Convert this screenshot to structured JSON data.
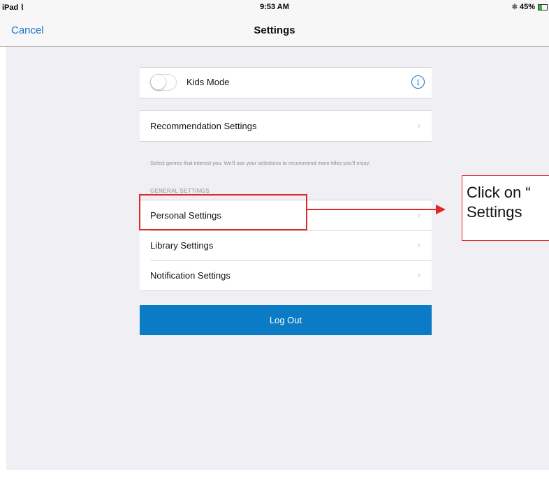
{
  "status_bar": {
    "device": "iPad",
    "time": "9:53 AM",
    "battery": "45%",
    "battery_level": 0.45
  },
  "nav": {
    "cancel_label": "Cancel",
    "title": "Settings"
  },
  "kids_mode": {
    "label": "Kids Mode",
    "enabled": false
  },
  "recommendation": {
    "label": "Recommendation Settings",
    "helper_text": "Select genres that interest you. We'll use your selections to recommend more titles you'll enjoy."
  },
  "general_settings": {
    "header": "GENERAL SETTINGS",
    "items": [
      {
        "label": "Personal Settings"
      },
      {
        "label": "Library Settings"
      },
      {
        "label": "Notification Settings"
      }
    ]
  },
  "logout_label": "Log Out",
  "annotation": {
    "line1": "Click on “",
    "line2": "Settings",
    "color": "#e3262b"
  },
  "colors": {
    "accent": "#1a73c9",
    "logout": "#0a7bc4",
    "background": "#efeff4"
  },
  "icons": {
    "wifi": "wifi-icon",
    "bluetooth": "bluetooth-icon",
    "battery": "battery-icon",
    "info": "info-icon",
    "chevron": "chevron-right-icon"
  }
}
